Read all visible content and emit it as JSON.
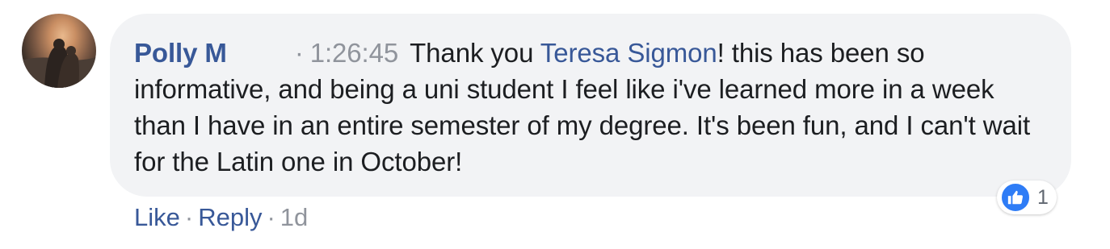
{
  "comment": {
    "author": "Polly M",
    "timestamp_dot": "·",
    "timestamp": "1:26:45",
    "text_before_mention": "Thank you ",
    "mention": "Teresa Sigmon",
    "text_after_mention": "! this has been so informative, and being a uni student I feel like i've learned more in a week than I have in an entire semester of my degree. It's been fun, and I can't wait for the Latin one in October!",
    "reaction_icon": "like-icon",
    "reaction_count": "1",
    "like_label": "Like",
    "separator": "·",
    "reply_label": "Reply",
    "age": "1d"
  },
  "colors": {
    "link_blue": "#385898",
    "bubble_bg": "#f2f3f5",
    "meta_gray": "#90949c",
    "like_blue": "#2e7cf6"
  }
}
